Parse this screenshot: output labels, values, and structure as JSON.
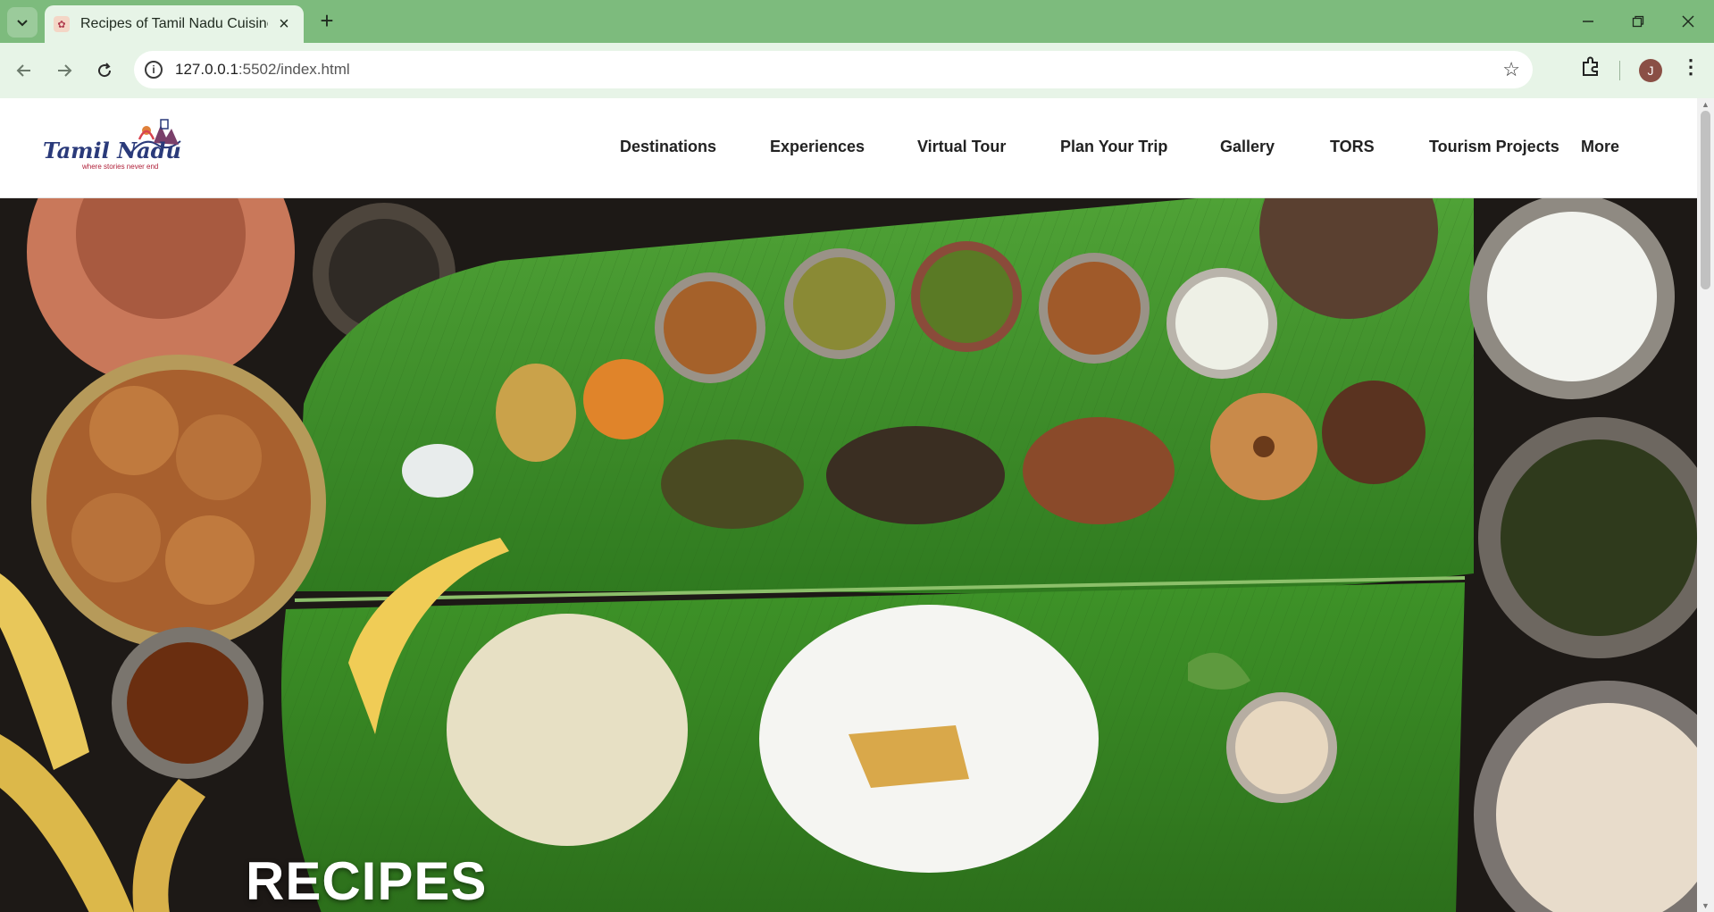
{
  "browser": {
    "tab_title": "Recipes of Tamil Nadu Cuisine |",
    "url_host": "127.0.0.1",
    "url_path": ":5502/index.html",
    "profile_initial": "J",
    "theme_color": "#7dbb7d"
  },
  "site": {
    "logo_text": "Tamil Nadu",
    "logo_tagline": "where stories never end",
    "nav": [
      {
        "label": "Destinations"
      },
      {
        "label": "Experiences"
      },
      {
        "label": "Virtual Tour"
      },
      {
        "label": "Plan Your Trip"
      },
      {
        "label": "Gallery"
      },
      {
        "label": "TORS"
      },
      {
        "label": "Tourism Projects"
      },
      {
        "label": "More"
      }
    ]
  },
  "hero": {
    "title": "RECIPES",
    "leaf_color": "#3f8f2a"
  }
}
